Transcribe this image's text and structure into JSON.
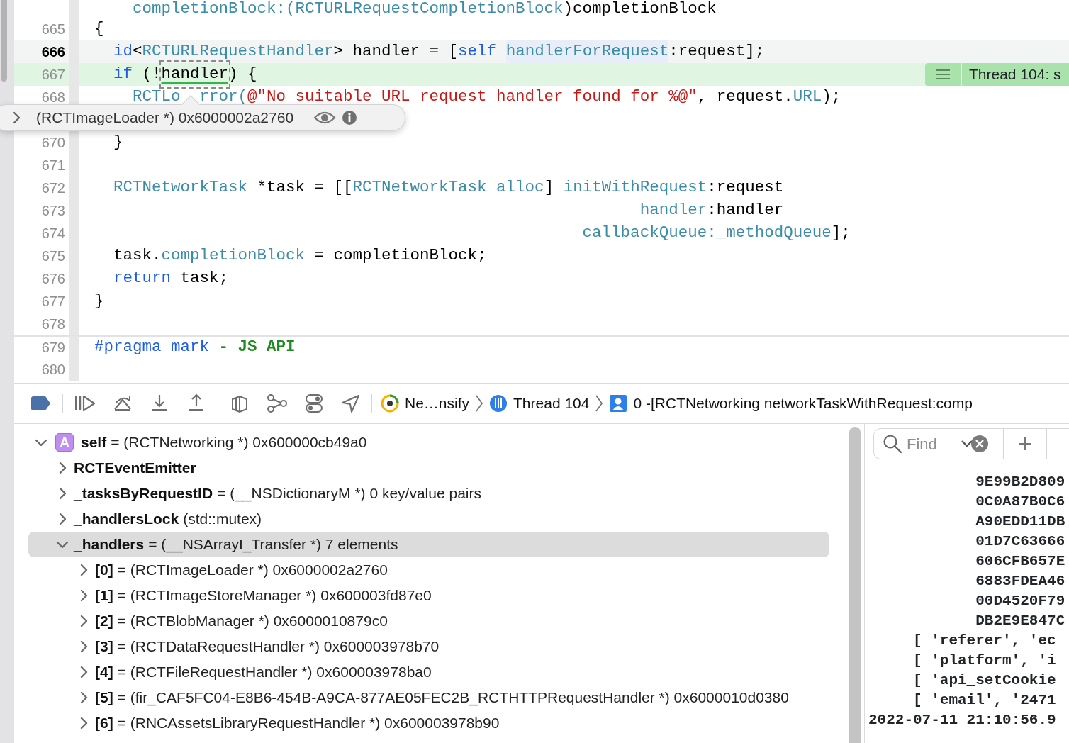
{
  "editor": {
    "lines": [
      {
        "current": false,
        "stopped": false,
        "code": [
          {
            "text": "    completionBlock:(RCTURLRequestCompletionBlock",
            "kind": "type"
          },
          {
            "text": ")completionBlock",
            "kind": "plain"
          }
        ]
      },
      {
        "number": "665",
        "current": false,
        "stopped": false,
        "code": [
          {
            "text": "{",
            "kind": "plain"
          }
        ]
      },
      {
        "number": "666",
        "current": true,
        "stopped": false,
        "code": [
          {
            "text": "  id",
            "kind": "keyword"
          },
          {
            "text": "<",
            "kind": "plain"
          },
          {
            "text": "RCTURLRequestHandler",
            "kind": "type"
          },
          {
            "text": "> handler = [",
            "kind": "plain"
          },
          {
            "text": "self ",
            "kind": "keyword"
          },
          {
            "text": "handlerForRequest",
            "kind": "selector"
          },
          {
            "text": ":request];",
            "kind": "plain"
          }
        ]
      },
      {
        "number": "667",
        "current": false,
        "stopped": true,
        "badge": "Thread 104: s",
        "code": [
          {
            "text": "  if",
            "kind": "keyword"
          },
          {
            "text": " (!",
            "kind": "plain"
          },
          {
            "text": "handler",
            "kind": "inspected"
          },
          {
            "text": ") {",
            "kind": "plain"
          }
        ]
      },
      {
        "number": "668",
        "current": false,
        "stopped": false,
        "code": [
          {
            "text": "    RCTLo",
            "kind": "type"
          },
          {
            "text": "rror(",
            "kind": "covered-type"
          },
          {
            "text": "@\"No suitable URL request handler found for %@\"",
            "kind": "string"
          },
          {
            "text": ", request.",
            "kind": "plain"
          },
          {
            "text": "URL",
            "kind": "type"
          },
          {
            "text": ");",
            "kind": "plain"
          }
        ]
      },
      {
        "kind": "popover",
        "value": "(RCTImageLoader *) 0x6000002a2760",
        "expanded": false
      },
      {
        "number": "670",
        "current": false,
        "stopped": false,
        "code": [
          {
            "text": "  }",
            "kind": "plain"
          }
        ]
      },
      {
        "number": "671",
        "current": false,
        "stopped": false
      },
      {
        "number": "672",
        "current": false,
        "stopped": false,
        "code": [
          {
            "text": "  RCTNetworkTask",
            "kind": "type"
          },
          {
            "text": " *task = [[",
            "kind": "plain"
          },
          {
            "text": "RCTNetworkTask alloc",
            "kind": "type"
          },
          {
            "text": "] ",
            "kind": "plain"
          },
          {
            "text": "initWithRequest",
            "kind": "type"
          },
          {
            "text": ":request",
            "kind": "plain"
          }
        ]
      },
      {
        "number": "673",
        "current": false,
        "stopped": false,
        "code": [
          {
            "text": "                                                         handler",
            "kind": "type"
          },
          {
            "text": ":handler",
            "kind": "plain"
          }
        ]
      },
      {
        "number": "674",
        "current": false,
        "stopped": false,
        "code": [
          {
            "text": "                                                   callbackQueue",
            "kind": "type"
          },
          {
            "text": ":_methodQueue",
            "kind": "type"
          },
          {
            "text": "];",
            "kind": "plain"
          }
        ]
      },
      {
        "number": "675",
        "current": false,
        "stopped": false,
        "code": [
          {
            "text": "  task.",
            "kind": "plain"
          },
          {
            "text": "completionBlock",
            "kind": "type"
          },
          {
            "text": " = completionBlock;",
            "kind": "plain"
          }
        ]
      },
      {
        "number": "676",
        "current": false,
        "stopped": false,
        "code": [
          {
            "text": "  return",
            "kind": "keyword"
          },
          {
            "text": " task;",
            "kind": "plain"
          }
        ]
      },
      {
        "number": "677",
        "current": false,
        "stopped": false,
        "code": [
          {
            "text": "}",
            "kind": "plain"
          }
        ]
      },
      {
        "number": "678",
        "current": false,
        "stopped": false
      },
      {
        "number": "679",
        "current": false,
        "stopped": false,
        "code": [
          {
            "text": "#pragma mark",
            "kind": "directive"
          },
          {
            "text": " - JS API",
            "kind": "mark"
          }
        ]
      },
      {
        "number": "680",
        "current": false,
        "stopped": false
      }
    ]
  },
  "debug_bar": {
    "breakpoints_enabled": true,
    "breadcrumb": [
      {
        "kind": "app",
        "label": "Ne…nsify"
      },
      {
        "kind": "thread",
        "label": "Thread 104"
      },
      {
        "kind": "frame",
        "label": "0 -[RCTNetworking networkTaskWithRequest:comp"
      }
    ]
  },
  "variables": [
    {
      "badge": "A",
      "name": "self",
      "summary": "= (RCTNetworking *) 0x600000cb49a0",
      "expanded": true,
      "selected": false,
      "children": [
        {
          "name": "RCTEventEmitter",
          "expanded": false,
          "selected": false
        },
        {
          "name": "_tasksByRequestID",
          "summary": "= (__NSDictionaryM *) 0 key/value pairs",
          "expanded": false,
          "selected": false
        },
        {
          "name": "_handlersLock",
          "summary": "(std::mutex)",
          "expanded": false,
          "selected": false
        },
        {
          "name": "_handlers",
          "summary": "= (__NSArrayI_Transfer *) 7 elements",
          "expanded": true,
          "selected": true,
          "children": [
            {
              "name": "[0]",
              "summary": "= (RCTImageLoader *) 0x6000002a2760",
              "expanded": false,
              "selected": false
            },
            {
              "name": "[1]",
              "summary": "= (RCTImageStoreManager *) 0x600003fd87e0",
              "expanded": false,
              "selected": false
            },
            {
              "name": "[2]",
              "summary": "= (RCTBlobManager *) 0x6000010879c0",
              "expanded": false,
              "selected": false
            },
            {
              "name": "[3]",
              "summary": "= (RCTDataRequestHandler *) 0x600003978b70",
              "expanded": false,
              "selected": false
            },
            {
              "name": "[4]",
              "summary": "= (RCTFileRequestHandler *) 0x600003978ba0",
              "expanded": false,
              "selected": false
            },
            {
              "name": "[5]",
              "summary": "= (fir_CAF5FC04-E8B6-454B-A9CA-877AE05FEC2B_RCTHTTPRequestHandler *) 0x6000010d0380",
              "expanded": false,
              "selected": false
            },
            {
              "name": "[6]",
              "summary": "= (RNCAssetsLibraryRequestHandler *) 0x600003978b90",
              "expanded": false,
              "selected": false
            }
          ]
        }
      ]
    }
  ],
  "console": {
    "find": {
      "placeholder": "Find"
    },
    "lines": [
      {
        "kind": "hex",
        "text": "9E99B2D809"
      },
      {
        "kind": "hex",
        "text": "0C0A87B0C6"
      },
      {
        "kind": "hex",
        "text": "A90EDD11DB"
      },
      {
        "kind": "hex",
        "text": "01D7C63666"
      },
      {
        "kind": "hex",
        "text": "606CFB657E"
      },
      {
        "kind": "hex",
        "text": "6883FDEA46"
      },
      {
        "kind": "hex",
        "text": "00D4520F79"
      },
      {
        "kind": "hex",
        "text": "DB2E9E847C"
      },
      {
        "kind": "entry",
        "text": "[ 'referer', 'ec"
      },
      {
        "kind": "entry",
        "text": "[ 'platform', 'i"
      },
      {
        "kind": "entry",
        "text": "[ 'api_setCookie"
      },
      {
        "kind": "entry",
        "text": "[ 'email', '2471"
      },
      {
        "kind": "log",
        "text": "2022-07-11 21:10:56.9"
      }
    ]
  }
}
